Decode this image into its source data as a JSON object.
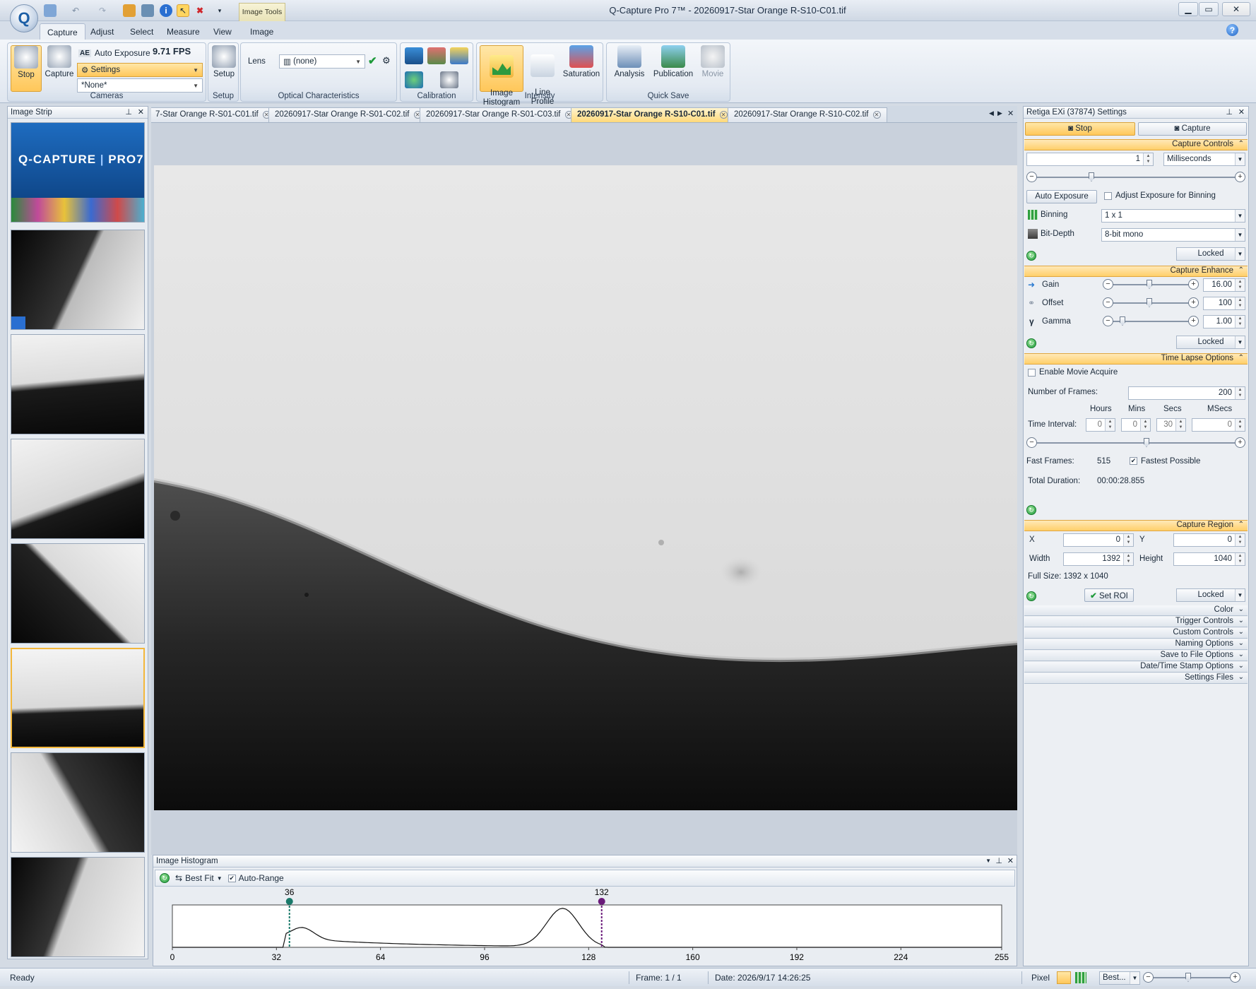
{
  "window": {
    "title": "Q-Capture Pro 7™ - 20260917-Star Orange R-S10-C01.tif",
    "contextual_tab": "Image Tools"
  },
  "ribbon_tabs": [
    "Capture",
    "Adjust",
    "Select",
    "Measure",
    "View",
    "Image"
  ],
  "ribbon": {
    "stop": "Stop",
    "capture": "Capture",
    "auto_exposure": "Auto Exposure",
    "fps": "9.71 FPS",
    "settings": "Settings",
    "preset": "*None*",
    "group_cameras": "Cameras",
    "setup": "Setup",
    "group_setup": "Setup",
    "lens_label": "Lens",
    "lens_value": "(none)",
    "group_optical": "Optical Characteristics",
    "group_calibration": "Calibration",
    "image_histogram": "Image\nHistogram",
    "line_profile": "Line\nProfile",
    "saturation": "Saturation",
    "group_intensity": "Intensity",
    "analysis": "Analysis",
    "publication": "Publication",
    "movie": "Movie",
    "group_quicksave": "Quick Save"
  },
  "image_strip": {
    "title": "Image Strip",
    "banner_title": "Q-CAPTURE",
    "banner_pro": "PRO7"
  },
  "doc_tabs": [
    "7-Star Orange R-S01-C01.tif",
    "20260917-Star Orange R-S01-C02.tif",
    "20260917-Star Orange R-S01-C03.tif",
    "20260917-Star Orange R-S10-C01.tif",
    "20260917-Star Orange R-S10-C02.tif"
  ],
  "active_doc_tab": 3,
  "histogram": {
    "title": "Image Histogram",
    "fit": "Best Fit",
    "auto_range": "Auto-Range",
    "auto_range_checked": true,
    "marker_low": "36",
    "marker_high": "132",
    "ticks": [
      "0",
      "32",
      "64",
      "96",
      "128",
      "160",
      "192",
      "224",
      "255"
    ],
    "x_range": [
      0,
      255
    ]
  },
  "settings": {
    "title": "Retiga EXi (37874) Settings",
    "stop": "Stop",
    "capture": "Capture",
    "capture_controls": "Capture Controls",
    "exposure_value": "1",
    "exposure_unit": "Milliseconds",
    "auto_exposure": "Auto Exposure",
    "adjust_binning": "Adjust Exposure for Binning",
    "binning_label": "Binning",
    "binning_value": "1 x 1",
    "bitdepth_label": "Bit-Depth",
    "bitdepth_value": "8-bit mono",
    "locked": "Locked",
    "capture_enhance": "Capture Enhance",
    "gain_label": "Gain",
    "gain_value": "16.00",
    "offset_label": "Offset",
    "offset_value": "100",
    "gamma_label": "Gamma",
    "gamma_value": "1.00",
    "time_lapse": "Time Lapse Options",
    "enable_movie": "Enable Movie Acquire",
    "frames_label": "Number of  Frames:",
    "frames_value": "200",
    "hours": "Hours",
    "mins": "Mins",
    "secs": "Secs",
    "msecs": "MSecs",
    "interval_label": "Time Interval:",
    "interval": [
      "0",
      "0",
      "30",
      "0"
    ],
    "fast_frames_label": "Fast Frames:",
    "fast_frames_value": "515",
    "fastest_possible": "Fastest Possible",
    "total_duration_label": "Total Duration:",
    "total_duration_value": "00:00:28.855",
    "capture_region": "Capture Region",
    "x_label": "X",
    "x_value": "0",
    "y_label": "Y",
    "y_value": "0",
    "width_label": "Width",
    "width_value": "1392",
    "height_label": "Height",
    "height_value": "1040",
    "full_size": "Full Size: 1392 x 1040",
    "set_roi": "Set ROI",
    "collapsed_sections": [
      "Color",
      "Trigger Controls",
      "Custom Controls",
      "Naming Options",
      "Save to File Options",
      "Date/Time Stamp Options",
      "Settings Files"
    ]
  },
  "status": {
    "ready": "Ready",
    "frame": "Frame: 1 / 1",
    "date": "Date: 2026/9/17 14:26:25",
    "pixel": "Pixel",
    "zoom": "Best..."
  }
}
